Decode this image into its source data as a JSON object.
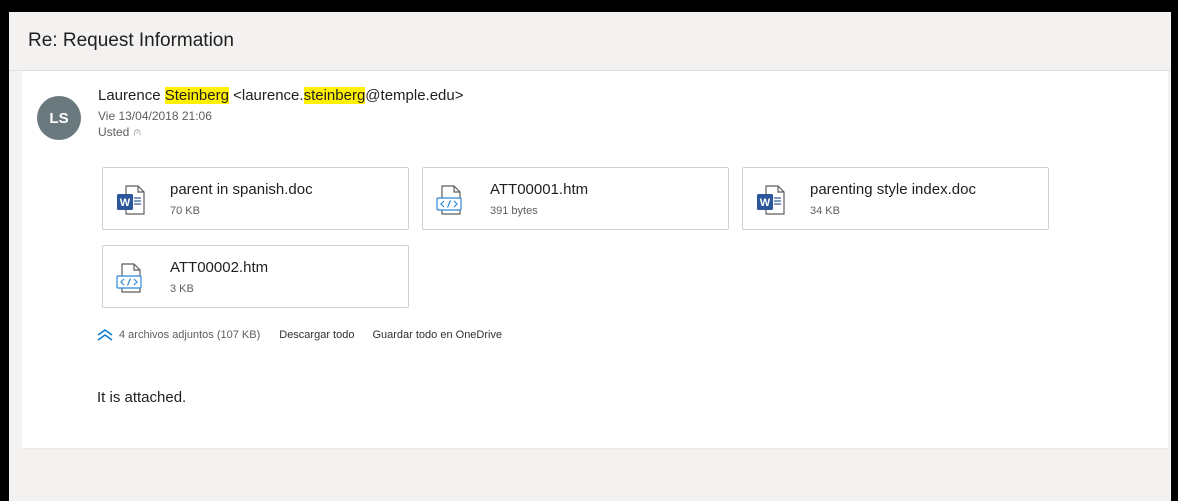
{
  "subject": "Re: Request Information",
  "sender": {
    "initials": "LS",
    "name_first": "Laurence ",
    "name_highlight": "Steinberg",
    "email_prefix": " <laurence.",
    "email_highlight": "steinberg",
    "email_suffix": "@temple.edu>",
    "date": "Vie 13/04/2018 21:06",
    "to": "Usted"
  },
  "attachments": [
    {
      "name": "parent in spanish.doc",
      "size": "70 KB",
      "icon": "word-doc-icon"
    },
    {
      "name": "ATT00001.htm",
      "size": "391 bytes",
      "icon": "html-file-icon"
    },
    {
      "name": "parenting style index.doc",
      "size": "34 KB",
      "icon": "word-doc-icon"
    },
    {
      "name": "ATT00002.htm",
      "size": "3 KB",
      "icon": "html-file-icon"
    }
  ],
  "attachment_summary": {
    "count_text": "4 archivos adjuntos (107 KB)",
    "download_all": "Descargar todo",
    "save_onedrive": "Guardar todo en OneDrive"
  },
  "body": "It is attached.",
  "colors": {
    "highlight": "#fff100",
    "word_blue": "#2b579a",
    "accent": "#0078d4",
    "avatar": "#69797e"
  }
}
